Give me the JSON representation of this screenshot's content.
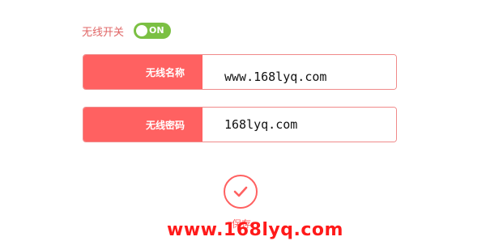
{
  "wireless_switch": {
    "label": "无线开关",
    "state": "ON"
  },
  "ssid": {
    "label": "无线名称",
    "value": "www.168lyq.com"
  },
  "password": {
    "label": "无线密码",
    "value": "168lyq.com"
  },
  "save": {
    "label": "保存"
  },
  "watermark": "www.168lyq.com",
  "colors": {
    "accent": "#ff6161",
    "toggle_on": "#7bc043",
    "watermark": "#ff1a1a"
  }
}
